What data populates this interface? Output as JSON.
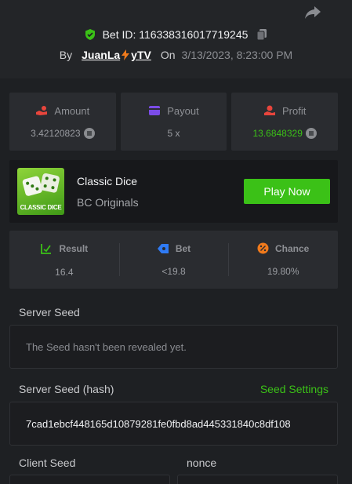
{
  "header": {
    "bet_id": "Bet ID: 116338316017719245",
    "by_label": "By",
    "user_name_left": "JuanLa",
    "user_name_right": "yTV",
    "on_label": "On",
    "date": "3/13/2023, 8:23:00 PM"
  },
  "stats": {
    "amount": {
      "label": "Amount",
      "value": "3.42120823"
    },
    "payout": {
      "label": "Payout",
      "value": "5 x"
    },
    "profit": {
      "label": "Profit",
      "value": "13.6848329"
    }
  },
  "game": {
    "thumb_label": "CLASSIC DICE",
    "title": "Classic Dice",
    "provider": "BC Originals",
    "play_label": "Play Now"
  },
  "result_panel": {
    "result": {
      "label": "Result",
      "value": "16.4"
    },
    "bet": {
      "label": "Bet",
      "value": "<19.8"
    },
    "chance": {
      "label": "Chance",
      "value": "19.80%"
    }
  },
  "seeds": {
    "server_seed_label": "Server Seed",
    "server_seed_value": "The Seed hasn't been revealed yet.",
    "server_hash_label": "Server Seed (hash)",
    "seed_settings_label": "Seed Settings",
    "server_hash_value": "7cad1ebcf448165d10879281fe0fbd8ad445331840c8df108",
    "client_seed_label": "Client Seed",
    "nonce_label": "nonce"
  },
  "colors": {
    "accent_green": "#3bc117",
    "background": "#232528",
    "panel": "#2a2c30",
    "profit_icon": "#e8453c",
    "payout_icon": "#7b4ce8",
    "bet_icon": "#2f7bf5",
    "chance_icon": "#f07a1c"
  },
  "icons": {
    "share": "share-arrow-icon",
    "shield": "shield-check-icon",
    "copy": "copy-icon",
    "lightning": "lightning-icon",
    "amount": "hand-coins-icon",
    "payout": "wallet-card-icon",
    "profit": "profit-hand-icon",
    "coin": "token-coin-icon",
    "dice": "dice-icon",
    "result": "chart-check-icon",
    "bet": "tag-icon",
    "chance": "percent-icon"
  }
}
